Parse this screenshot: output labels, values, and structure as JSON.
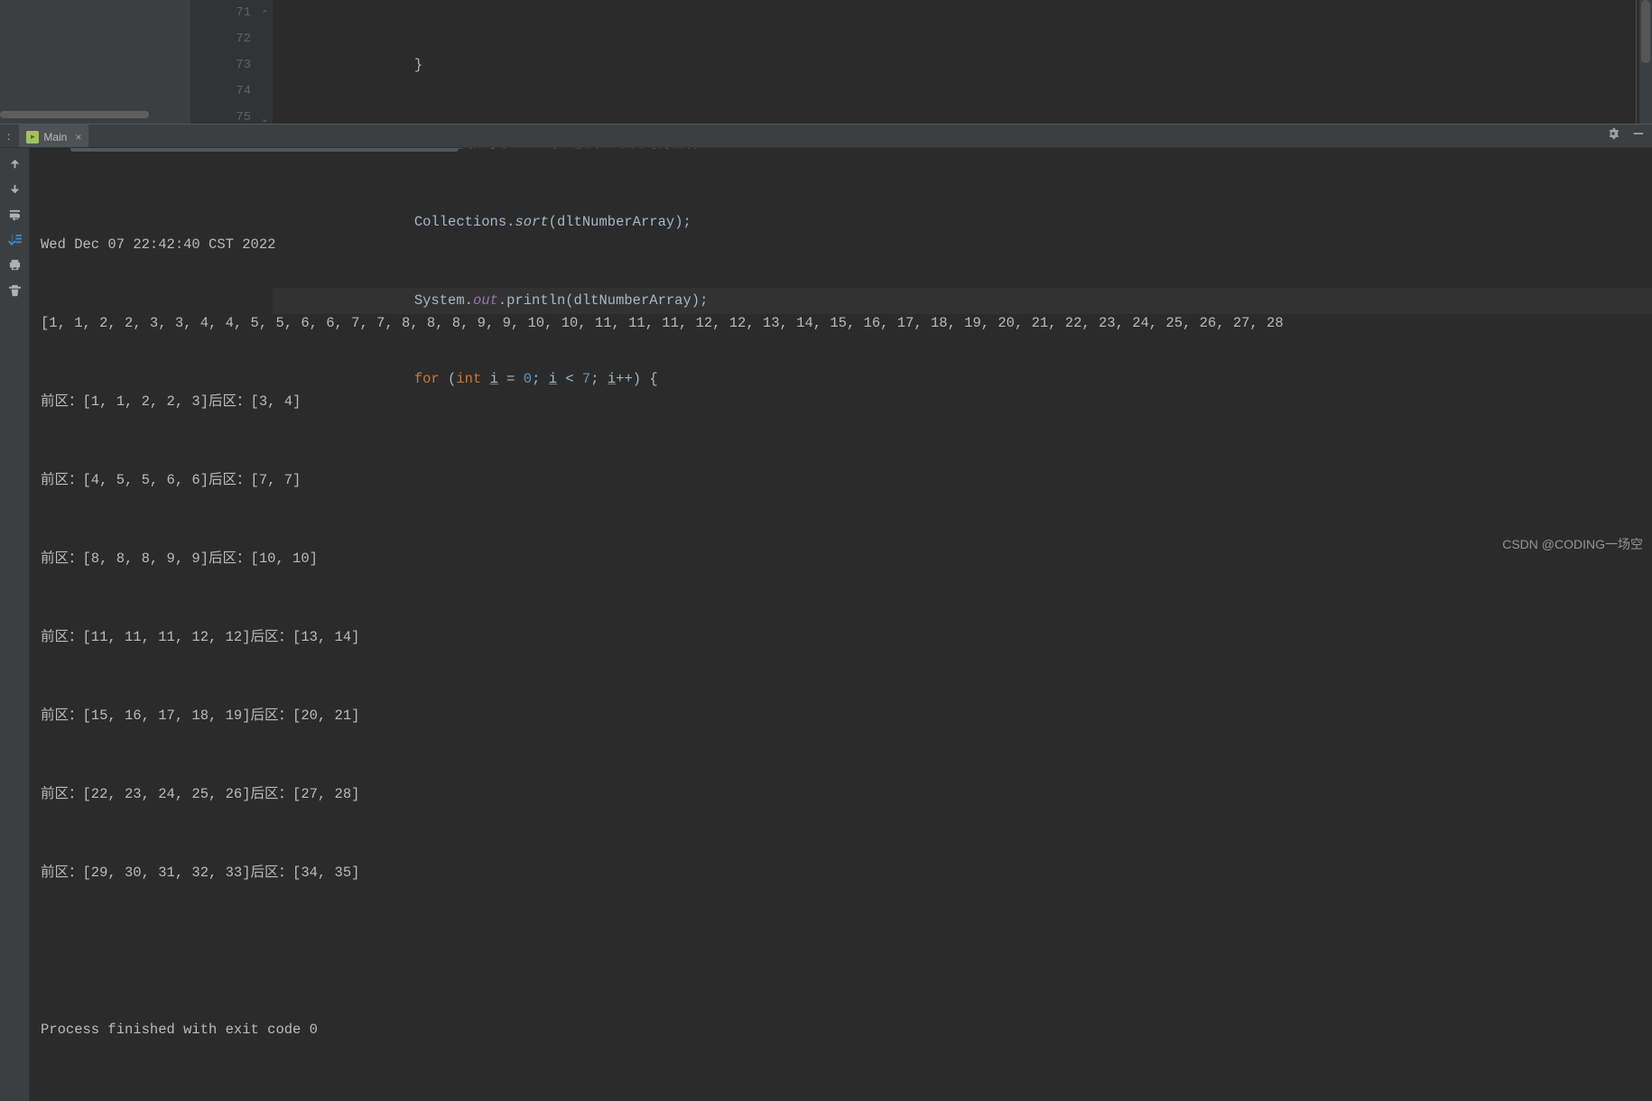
{
  "editor": {
    "lines": [
      {
        "num": "71",
        "html": "                }"
      },
      {
        "num": "72",
        "html": "                <span class='comment'>//不重复数字验证  可以放开以下代码行注释</span>"
      },
      {
        "num": "73",
        "html": "                Collections.<span class='method-s'>sort</span>(dltNumberArray);"
      },
      {
        "num": "74",
        "html": "                System.<span class='field'>out</span>.println(dltNumberArray);",
        "highlight": true
      },
      {
        "num": "75",
        "html": "                <span class='kw'>for</span> (<span class='kw'>int</span> <span class='underline'>i</span> = <span class='num'>0</span>; <span class='underline'>i</span> < <span class='num'>7</span>; <span class='underline'>i</span>++) {"
      }
    ]
  },
  "run": {
    "panelLabel": ":",
    "tabName": "Main",
    "output": [
      "Wed Dec 07 22:42:40 CST 2022",
      "[1, 1, 2, 2, 3, 3, 4, 4, 5, 5, 6, 6, 7, 7, 8, 8, 8, 9, 9, 10, 10, 11, 11, 11, 12, 12, 13, 14, 15, 16, 17, 18, 19, 20, 21, 22, 23, 24, 25, 26, 27, 28",
      "前区：[1, 1, 2, 2, 3]后区：[3, 4]",
      "前区：[4, 5, 5, 6, 6]后区：[7, 7]",
      "前区：[8, 8, 8, 9, 9]后区：[10, 10]",
      "前区：[11, 11, 11, 12, 12]后区：[13, 14]",
      "前区：[15, 16, 17, 18, 19]后区：[20, 21]",
      "前区：[22, 23, 24, 25, 26]后区：[27, 28]",
      "前区：[29, 30, 31, 32, 33]后区：[34, 35]",
      "",
      "Process finished with exit code 0"
    ]
  },
  "watermark": "CSDN @CODING一场空"
}
